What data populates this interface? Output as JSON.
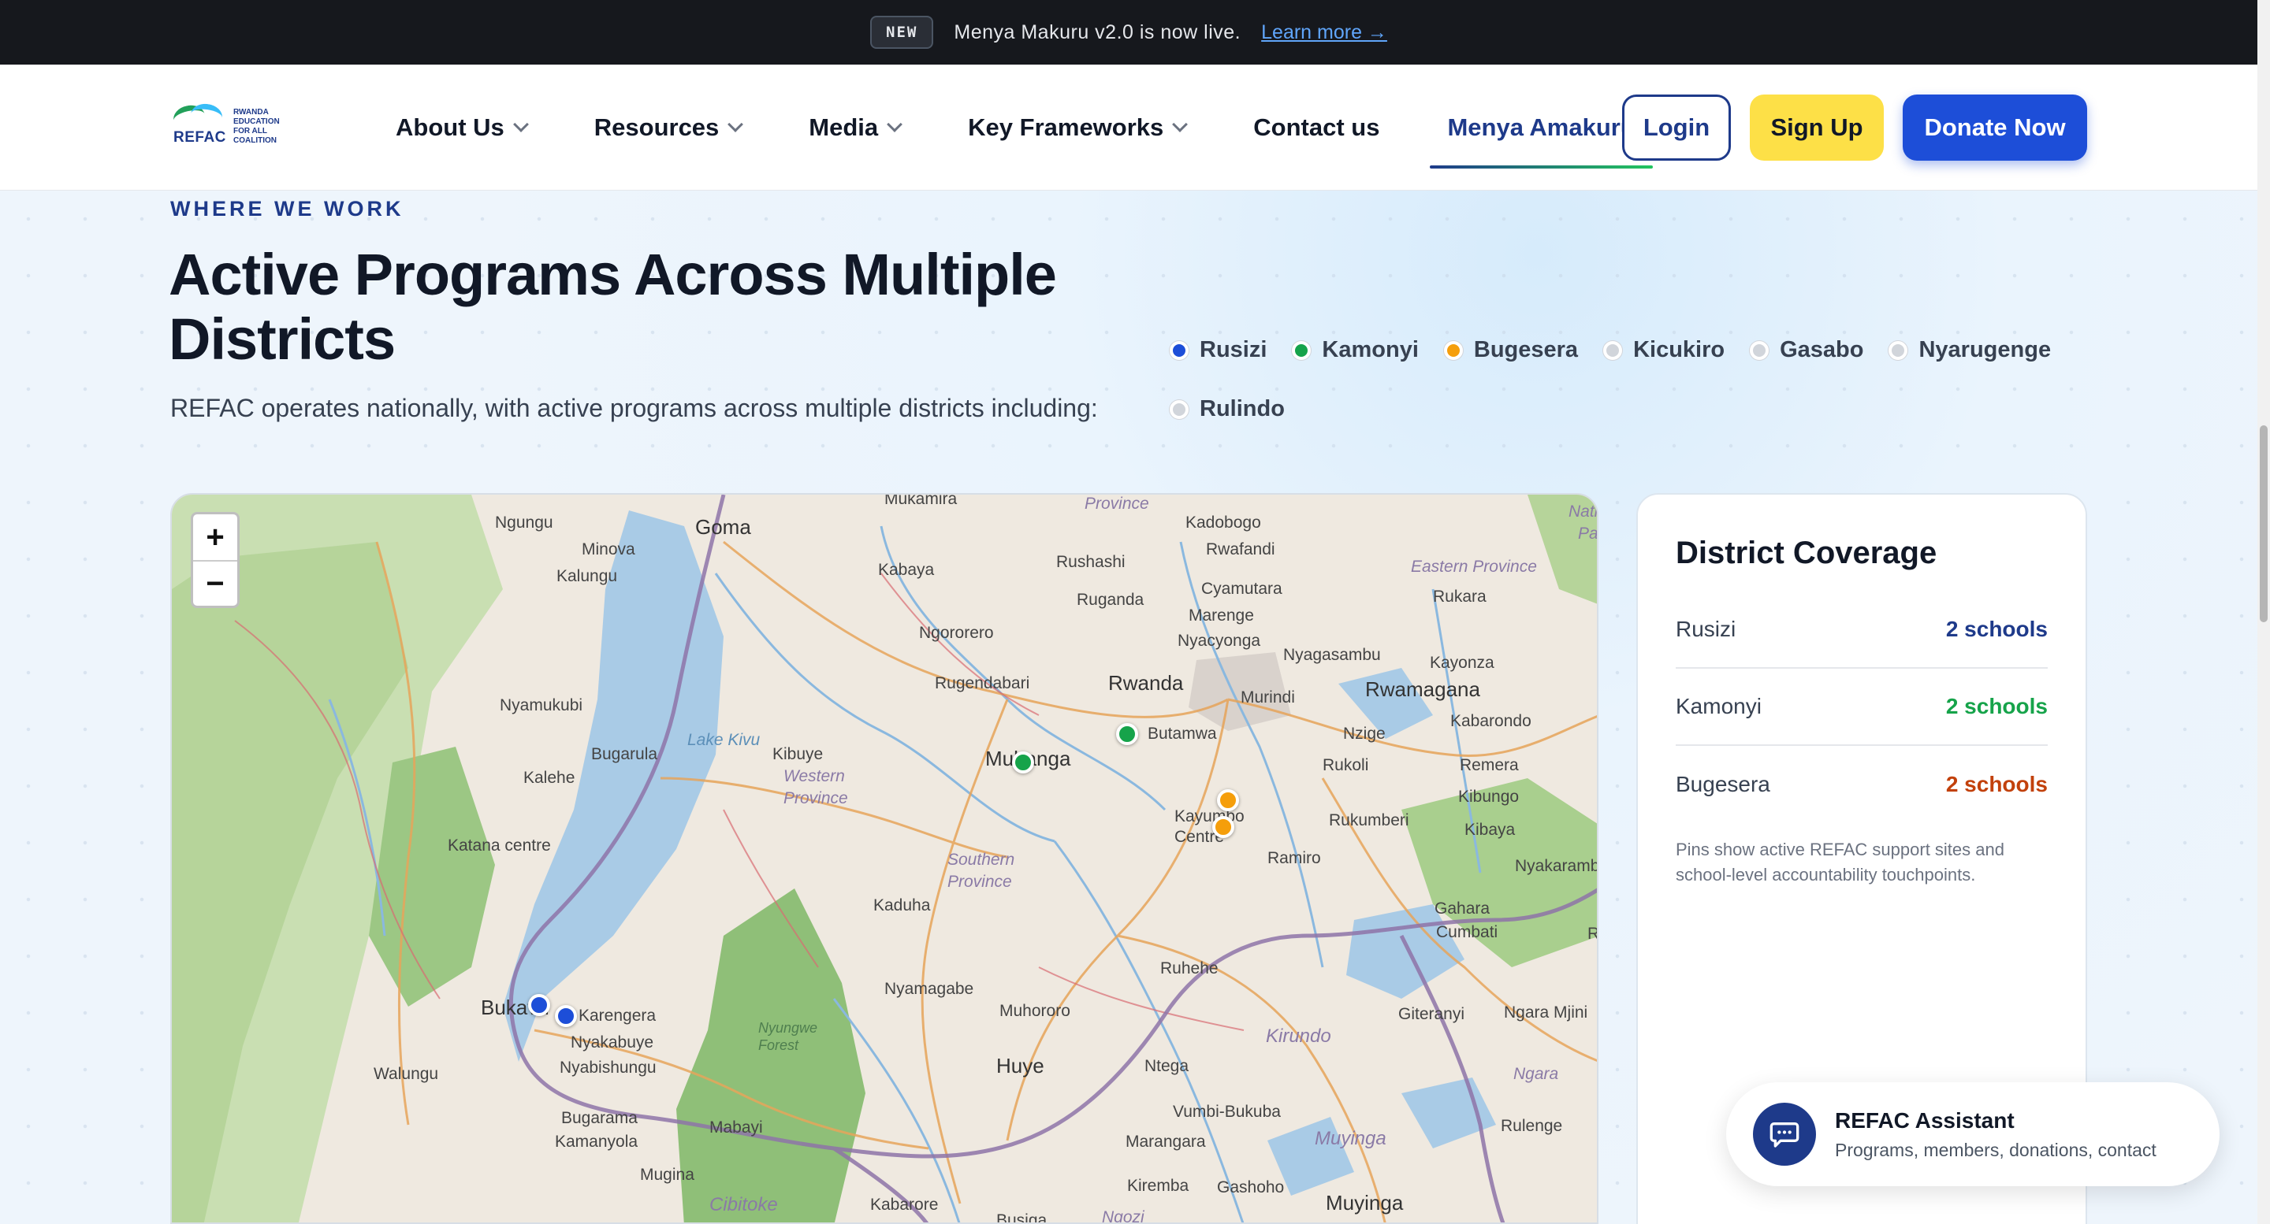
{
  "announcement": {
    "badge": "NEW",
    "text": "Menya Makuru v2.0 is now live.",
    "link": "Learn more →"
  },
  "header": {
    "logo": {
      "word": "REFAC",
      "small": "RWANDA EDUCATION FOR ALL COALITION"
    },
    "nav": [
      {
        "label": "About Us",
        "has_dropdown": true
      },
      {
        "label": "Resources",
        "has_dropdown": true
      },
      {
        "label": "Media",
        "has_dropdown": true
      },
      {
        "label": "Key Frameworks",
        "has_dropdown": true
      },
      {
        "label": "Contact us",
        "has_dropdown": false
      },
      {
        "label": "Menya Amakuru",
        "has_dropdown": false,
        "active": true
      }
    ],
    "login": "Login",
    "signup": "Sign Up",
    "donate": "Donate Now"
  },
  "section": {
    "eyebrow": "WHERE WE WORK",
    "title": "Active Programs Across Multiple Districts",
    "subtitle": "REFAC operates nationally, with active programs across multiple districts including:"
  },
  "legend": [
    {
      "label": "Rusizi",
      "color": "#1d4ed8"
    },
    {
      "label": "Kamonyi",
      "color": "#16a34a"
    },
    {
      "label": "Bugesera",
      "color": "#f59e0b"
    },
    {
      "label": "Kicukiro",
      "color": "#d1d5db"
    },
    {
      "label": "Gasabo",
      "color": "#d1d5db"
    },
    {
      "label": "Nyarugenge",
      "color": "#d1d5db"
    },
    {
      "label": "Rulindo",
      "color": "#d1d5db"
    }
  ],
  "map": {
    "zoom_in": "+",
    "zoom_out": "−",
    "labels": {
      "goma": "Goma",
      "ngungu": "Ngungu",
      "minova": "Minova",
      "kalungu": "Kalungu",
      "kabaya": "Kabaya",
      "mukamira": "Mukamira",
      "rushashi": "Rushashi",
      "ruganda": "Ruganda",
      "province_top": "Province",
      "kadobogo": "Kadobogo",
      "rwafandi": "Rwafandi",
      "cyamutara": "Cyamutara",
      "marenge": "Marenge",
      "nyacyonga": "Nyacyonga",
      "eastern_province": "Eastern Province",
      "rukara": "Rukara",
      "nati": "Nati",
      "pa": "Pa",
      "ngororero": "Ngororero",
      "rugendabari": "Rugendabari",
      "rwanda": "Rwanda",
      "nyagasambu": "Nyagasambu",
      "kayonza": "Kayonza",
      "murindi": "Murindi",
      "rwamagana": "Rwamagana",
      "nyamukubi": "Nyamukubi",
      "kabarondo": "Kabarondo",
      "bugarula": "Bugarula",
      "lake_kivu": "Lake Kivu",
      "kibuye": "Kibuye",
      "muhanga": "Muhanga",
      "butamwa": "Butamwa",
      "nzige": "Nzige",
      "kalehe": "Kalehe",
      "western_province": "Western Province",
      "rukoli": "Rukoli",
      "remera": "Remera",
      "kibungo": "Kibungo",
      "kayumbo_centre": "Kayumbo Centre",
      "rukumberi": "Rukumberi",
      "kibaya": "Kibaya",
      "katana_centre": "Katana centre",
      "southern_province": "Southern Province",
      "ramiro": "Ramiro",
      "nyakarambi": "Nyakarambi",
      "kaduha": "Kaduha",
      "gahara": "Gahara",
      "cumbati": "Cumbati",
      "ru": "Ru",
      "ruhehe": "Ruhehe",
      "nyamagabe": "Nyamagabe",
      "bukavu": "Bukavu",
      "karengera": "Karengera",
      "muhororo": "Muhororo",
      "giteranyi": "Giteranyi",
      "ngara_mjini": "Ngara Mjini",
      "nyakabuye": "Nyakabuye",
      "nyungwe_forest": "Nyungwe Forest",
      "kirundo": "Kirundo",
      "nyabishungu": "Nyabishungu",
      "walungu": "Walungu",
      "huye": "Huye",
      "ntega": "Ntega",
      "ngara": "Ngara",
      "bugarama": "Bugarama",
      "mabayi": "Mabayi",
      "vumbi_bukuba": "Vumbi-Bukuba",
      "kamanyola": "Kamanyola",
      "marangara": "Marangara",
      "muyinga_prov": "Muyinga",
      "rulenge": "Rulenge",
      "mugina": "Mugina",
      "kiremba": "Kiremba",
      "gashoho": "Gashoho",
      "cibitoke": "Cibitoke",
      "kabarore": "Kabarore",
      "muyinga": "Muyinga",
      "busiga": "Busiga",
      "ngozi": "Ngozi"
    }
  },
  "coverage": {
    "title": "District Coverage",
    "rows": [
      {
        "name": "Rusizi",
        "count": "2 schools",
        "color": "#1e3a8a"
      },
      {
        "name": "Kamonyi",
        "count": "2 schools",
        "color": "#16a34a"
      },
      {
        "name": "Bugesera",
        "count": "2 schools",
        "color": "#c2410c"
      }
    ],
    "note": "Pins show active REFAC support sites and school-level accountability touchpoints."
  },
  "assistant": {
    "title": "REFAC Assistant",
    "subtitle": "Programs, members, donations, contact",
    "icon": "chat-icon"
  }
}
